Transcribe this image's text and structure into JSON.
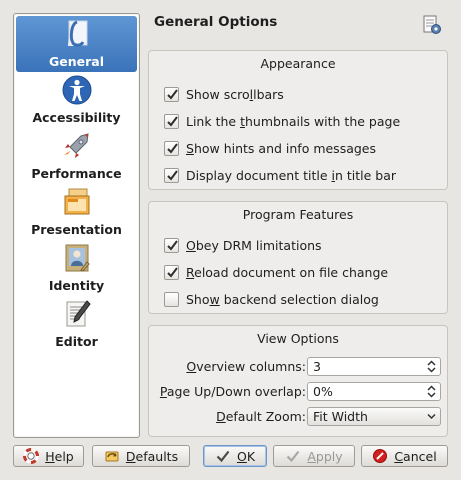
{
  "header": {
    "title": "General Options"
  },
  "sidebar": {
    "items": [
      {
        "label": "General",
        "icon": "general-icon",
        "selected": true
      },
      {
        "label": "Accessibility",
        "icon": "accessibility-icon",
        "selected": false
      },
      {
        "label": "Performance",
        "icon": "performance-icon",
        "selected": false
      },
      {
        "label": "Presentation",
        "icon": "presentation-icon",
        "selected": false
      },
      {
        "label": "Identity",
        "icon": "identity-icon",
        "selected": false
      },
      {
        "label": "Editor",
        "icon": "editor-icon",
        "selected": false
      }
    ]
  },
  "appearance": {
    "title": "Appearance",
    "options": [
      {
        "pre": "Show scro",
        "key": "l",
        "post": "lbars",
        "checked": true
      },
      {
        "pre": "Link the ",
        "key": "t",
        "post": "humbnails with the page",
        "checked": true
      },
      {
        "pre": "",
        "key": "S",
        "post": "how hints and info messages",
        "checked": true
      },
      {
        "pre": "Display document title ",
        "key": "i",
        "post": "n title bar",
        "checked": true
      }
    ]
  },
  "features": {
    "title": "Program Features",
    "options": [
      {
        "pre": "",
        "key": "O",
        "post": "bey DRM limitations",
        "checked": true
      },
      {
        "pre": "",
        "key": "R",
        "post": "eload document on file change",
        "checked": true
      },
      {
        "pre": "Sho",
        "key": "w",
        "post": " backend selection dialog",
        "checked": false
      }
    ]
  },
  "view": {
    "title": "View Options",
    "overview": {
      "pre": "",
      "key": "O",
      "post": "verview columns:",
      "value": "3"
    },
    "overlap": {
      "pre": "",
      "key": "P",
      "post": "age Up/Down overlap:",
      "value": "0%"
    },
    "zoom": {
      "pre": "",
      "key": "D",
      "post": "efault Zoom:",
      "value": "Fit Width"
    }
  },
  "buttons": {
    "help": {
      "pre": "",
      "key": "H",
      "post": "elp"
    },
    "defaults": {
      "pre": "",
      "key": "D",
      "post": "efaults"
    },
    "ok": {
      "pre": "",
      "key": "O",
      "post": "K"
    },
    "apply": {
      "pre": "",
      "key": "A",
      "post": "pply"
    },
    "cancel": {
      "pre": "",
      "key": "C",
      "post": "ancel"
    }
  },
  "colors": {
    "accent": "#4a82c6",
    "check": "#2d2d2d",
    "cancel_red": "#d2201e"
  }
}
